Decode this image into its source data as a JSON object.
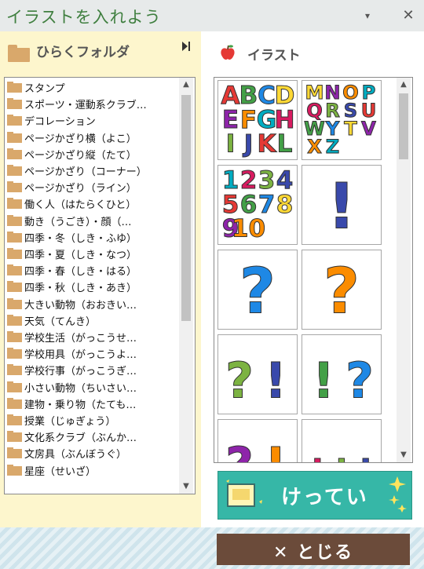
{
  "window": {
    "title": "イラストを入れよう",
    "minimize_glyph": "▾",
    "close_glyph": "✕"
  },
  "left_panel": {
    "title": "ひらくフォルダ",
    "folder_icon": "folder-icon",
    "collapse_glyph": "▶▏",
    "folders": [
      "スタンプ",
      "スポーツ・運動系クラブ…",
      "デコレーション",
      "ページかざり横（よこ）",
      "ページかざり縦（たて）",
      "ページかざり（コーナー）",
      "ページかざり（ライン）",
      "働く人（はたらくひと）",
      "動き（うごき）・顔（…",
      "四季・冬（しき・ふゆ）",
      "四季・夏（しき・なつ）",
      "四季・春（しき・はる）",
      "四季・秋（しき・あき）",
      "大きい動物（おおきい…",
      "天気（てんき）",
      "学校生活（がっこうせ…",
      "学校用具（がっこうよ…",
      "学校行事（がっこうぎ…",
      "小さい動物（ちいさい…",
      "建物・乗り物（たても…",
      "授業（じゅぎょう）",
      "文化系クラブ（ぶんか…",
      "文房具（ぶんぼうぐ）",
      "星座（せいざ）"
    ],
    "scroll_up_glyph": "▲",
    "scroll_down_glyph": "▼"
  },
  "right_panel": {
    "title": "イラスト",
    "icon": "apple-icon",
    "thumbnails": [
      {
        "name": "alphabet-a-l",
        "letters": [
          "A",
          "B",
          "C",
          "D",
          "E",
          "F",
          "G",
          "H",
          "I",
          "J",
          "K",
          "L"
        ]
      },
      {
        "name": "alphabet-m-z",
        "letters": [
          "M",
          "N",
          "O",
          "P",
          "Q",
          "R",
          "S",
          "U",
          "W",
          "Y",
          "T",
          "V",
          "X",
          "Z"
        ]
      },
      {
        "name": "numbers-1-10",
        "letters": [
          "1",
          "2",
          "3",
          "4",
          "5",
          "6",
          "7",
          "8",
          "9",
          "10"
        ]
      },
      {
        "name": "exclamation-orange",
        "letters": [
          "!"
        ]
      },
      {
        "name": "question-pastel",
        "letters": [
          "?"
        ]
      },
      {
        "name": "question-green",
        "letters": [
          "?"
        ]
      },
      {
        "name": "question-exclamation-stars",
        "letters": [
          "?",
          "!"
        ]
      },
      {
        "name": "question-exclamation-pink",
        "letters": [
          "!",
          "?"
        ]
      },
      {
        "name": "question-exclamation-purple",
        "letters": [
          "?",
          "!"
        ]
      },
      {
        "name": "exclamation-triple",
        "letters": [
          "!",
          "!",
          "!"
        ]
      }
    ]
  },
  "buttons": {
    "ok_label": "けってい",
    "close_label": "とじる",
    "close_glyph": "✕"
  },
  "colors": {
    "title_green": "#3f7f3f",
    "left_panel_bg": "#fdf6cd",
    "ok_teal": "#36b7a7",
    "close_brown": "#6b4b3a"
  }
}
